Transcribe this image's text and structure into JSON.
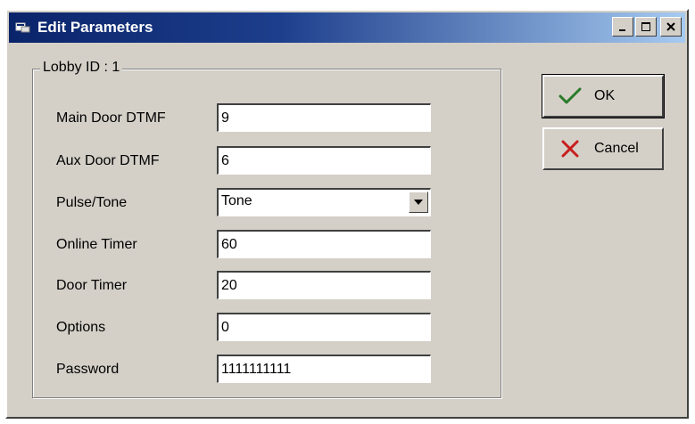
{
  "window": {
    "title": "Edit Parameters"
  },
  "icons": {
    "title_icon": "app-icon",
    "minimize": "minimize-icon",
    "maximize": "maximize-icon",
    "close": "close-icon",
    "ok": "checkmark-icon",
    "cancel": "x-icon",
    "dropdown": "chevron-down-icon"
  },
  "colors": {
    "titlebar_start": "#0a246a",
    "titlebar_end": "#a6caf0",
    "window_bg": "#d4d0c8",
    "ok_icon": "#2a7a2a",
    "cancel_icon": "#c81e1e"
  },
  "group": {
    "legend": "Lobby ID : 1"
  },
  "fields": [
    {
      "label": "Main Door DTMF",
      "value": "9"
    },
    {
      "label": "Aux Door DTMF",
      "value": "6"
    },
    {
      "label": "Pulse/Tone",
      "value": "Tone"
    },
    {
      "label": "Online Timer",
      "value": "60"
    },
    {
      "label": "Door Timer",
      "value": "20"
    },
    {
      "label": "Options",
      "value": "0"
    },
    {
      "label": "Password",
      "value": "1111111111"
    }
  ],
  "buttons": {
    "ok": "OK",
    "cancel": "Cancel"
  }
}
